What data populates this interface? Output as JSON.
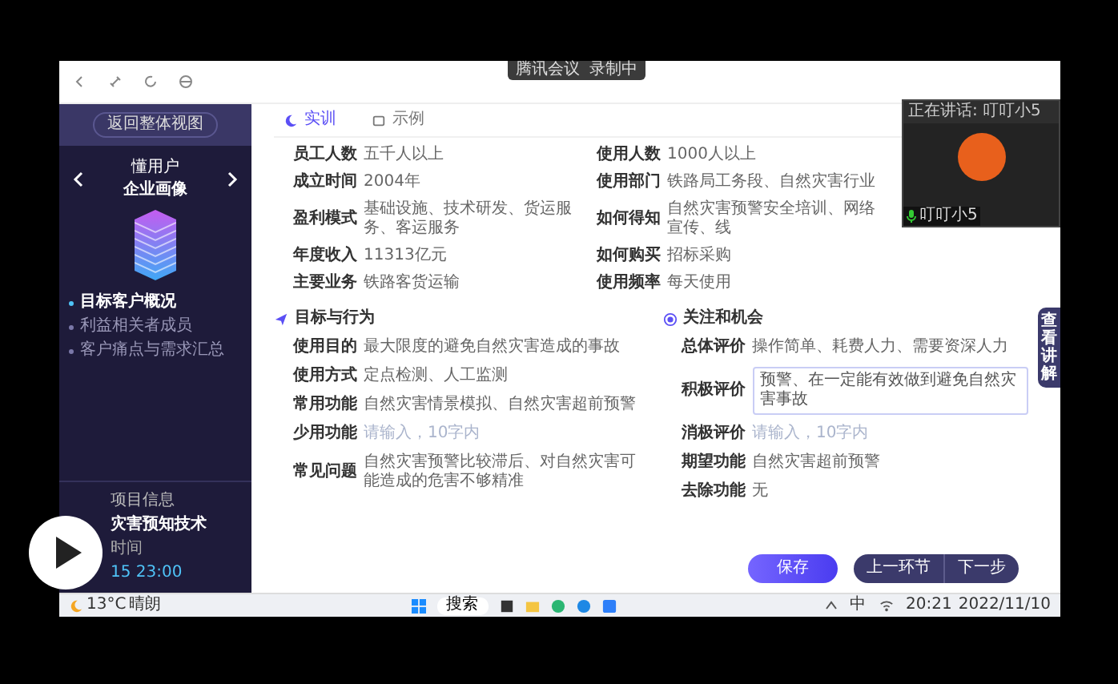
{
  "meeting_bar": {
    "app": "腾讯会议",
    "recording": "录制中"
  },
  "sidebar": {
    "back_button": "返回整体视图",
    "subtitle": "懂用户",
    "title": "企业画像",
    "nav": [
      {
        "label": "目标客户概况",
        "selected": true
      },
      {
        "label": "利益相关者成员",
        "selected": false
      },
      {
        "label": "客户痛点与需求汇总",
        "selected": false
      }
    ],
    "project": {
      "heading": "项目信息",
      "name": "灾害预知技术",
      "time_label": "时间",
      "time": "15 23:00"
    }
  },
  "tabs": [
    {
      "label": "实训",
      "selected": true
    },
    {
      "label": "示例",
      "selected": false
    }
  ],
  "profile": {
    "left": [
      {
        "label": "员工人数",
        "value": "五千人以上"
      },
      {
        "label": "成立时间",
        "value": "2004年"
      },
      {
        "label": "盈利模式",
        "value": "基础设施、技术研发、货运服务、客运服务"
      },
      {
        "label": "年度收入",
        "value": "11313亿元"
      },
      {
        "label": "主要业务",
        "value": "铁路客货运输"
      }
    ],
    "right": [
      {
        "label": "使用人数",
        "value": "1000人以上"
      },
      {
        "label": "使用部门",
        "value": "铁路局工务段、自然灾害行业"
      },
      {
        "label": "如何得知",
        "value": "自然灾害预警安全培训、网络宣传、线"
      },
      {
        "label": "如何购买",
        "value": "招标采购"
      },
      {
        "label": "使用频率",
        "value": "每天使用"
      }
    ]
  },
  "sections": [
    {
      "title": "目标与行为",
      "rows": [
        {
          "kind": "text",
          "label": "使用目的",
          "value": "最大限度的避免自然灾害造成的事故"
        },
        {
          "kind": "text",
          "label": "使用方式",
          "value": "定点检测、人工监测"
        },
        {
          "kind": "text",
          "label": "常用功能",
          "value": "自然灾害情景模拟、自然灾害超前预警"
        },
        {
          "kind": "placeholder",
          "label": "少用功能",
          "placeholder": "请输入，10字内"
        },
        {
          "kind": "text",
          "label": "常见问题",
          "value": "自然灾害预警比较滞后、对自然灾害可能造成的危害不够精准"
        }
      ]
    },
    {
      "title": "关注和机会",
      "rows": [
        {
          "kind": "text",
          "label": "总体评价",
          "value": "操作简单、耗费人力、需要资深人力"
        },
        {
          "kind": "input",
          "label": "积极评价",
          "value": "预警、在一定能有效做到避免自然灾害事故"
        },
        {
          "kind": "placeholder",
          "label": "消极评价",
          "placeholder": "请输入，10字内"
        },
        {
          "kind": "text",
          "label": "期望功能",
          "value": "自然灾害超前预警"
        },
        {
          "kind": "text",
          "label": "去除功能",
          "value": "无"
        }
      ]
    }
  ],
  "buttons": {
    "save": "保存",
    "prev": "上一环节",
    "next": "下一步"
  },
  "side_tab": "查看讲解",
  "meeting_popup": {
    "status": "正在讲话: 叮叮小5",
    "name": "叮叮小5"
  },
  "taskbar": {
    "temperature": "13°C",
    "weather": "晴朗",
    "search": "搜索",
    "ime": "中",
    "time": "20:21",
    "date": "2022/11/10"
  }
}
